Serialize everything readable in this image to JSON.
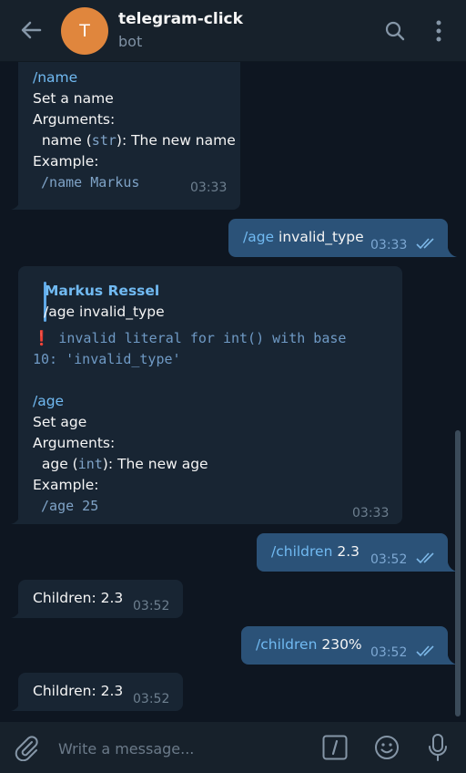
{
  "header": {
    "avatar_letter": "T",
    "title": "telegram-click",
    "subtitle": "bot"
  },
  "messages": {
    "m1": {
      "cmd": "/name",
      "l2": "Set a name",
      "l3": "Arguments:",
      "l4_pre": "  name (",
      "l4_type": "str",
      "l4_post": "): The new name",
      "l5": "Example:",
      "l6": " /name Markus",
      "time": "03:33"
    },
    "m2": {
      "cmd": "/age",
      "text": " invalid_type",
      "time": "03:33"
    },
    "m3": {
      "quote_author": "Markus Ressel",
      "quote_text": "/age invalid_type",
      "err_icon": "❗",
      "err1": " invalid literal for int() with base",
      "err2": "10: 'invalid_type'",
      "cmd": "/age",
      "l2": "Set age",
      "l3": "Arguments:",
      "l4_pre": "  age (",
      "l4_type": "int",
      "l4_post": "): The new age",
      "l5": "Example:",
      "l6": " /age 25",
      "time": "03:33"
    },
    "m4": {
      "cmd": "/children",
      "text": " 2.3",
      "time": "03:52"
    },
    "m5": {
      "text": "Children: 2.3",
      "time": "03:52"
    },
    "m6": {
      "cmd": "/children",
      "text": " 230%",
      "time": "03:52"
    },
    "m7": {
      "text": "Children: 2.3",
      "time": "03:52"
    }
  },
  "composer": {
    "placeholder": "Write a message..."
  },
  "icons": {
    "back": "arrow-left-icon",
    "search": "search-icon",
    "more": "more-vertical-icon",
    "attach": "paperclip-icon",
    "commands": "slash-command-icon",
    "emoji": "emoji-icon",
    "mic": "microphone-icon"
  },
  "colors": {
    "background": "#0e1621",
    "header": "#17212b",
    "incoming": "#182533",
    "outgoing": "#2b5278",
    "link": "#71baf2",
    "avatar": "#e0863d"
  }
}
